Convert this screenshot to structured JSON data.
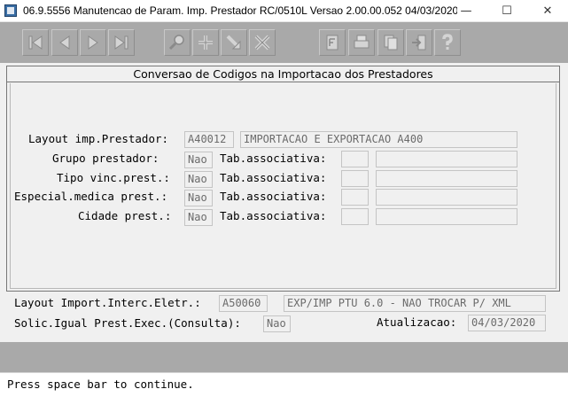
{
  "window": {
    "title": "06.9.5556 Manutencao  de Param. Imp. Prestador RC/0510L Versao 2.00.00.052 04/03/2020...",
    "minimize_glyph": "—",
    "maximize_glyph": "☐",
    "close_glyph": "✕"
  },
  "toolbar": {
    "buttons": [
      {
        "icon": "first-record-icon"
      },
      {
        "icon": "previous-record-icon"
      },
      {
        "icon": "next-record-icon"
      },
      {
        "icon": "last-record-icon"
      },
      {
        "icon": "search-icon"
      },
      {
        "icon": "add-icon"
      },
      {
        "icon": "edit-icon"
      },
      {
        "icon": "delete-icon"
      },
      {
        "icon": "filter-icon"
      },
      {
        "icon": "print-icon"
      },
      {
        "icon": "copy-icon"
      },
      {
        "icon": "exit-icon"
      },
      {
        "icon": "help-icon"
      }
    ]
  },
  "panel": {
    "title": "Conversao de Codigos na Importacao dos Prestadores",
    "rows": [
      {
        "label": "Layout imp.Prestador:",
        "value": "A40012",
        "description": "IMPORTACAO E EXPORTACAO A400"
      },
      {
        "label": "Grupo prestador:",
        "value": "Nao",
        "assoc_label": "Tab.associativa:",
        "assoc_code": "",
        "assoc_desc": ""
      },
      {
        "label": "Tipo vinc.prest.:",
        "value": "Nao",
        "assoc_label": "Tab.associativa:",
        "assoc_code": "",
        "assoc_desc": ""
      },
      {
        "label": "Especial.medica prest.:",
        "value": "Nao",
        "assoc_label": "Tab.associativa:",
        "assoc_code": "",
        "assoc_desc": ""
      },
      {
        "label": "Cidade prest.:",
        "value": "Nao",
        "assoc_label": "Tab.associativa:",
        "assoc_code": "",
        "assoc_desc": ""
      }
    ]
  },
  "footer_fields": {
    "layout_interc_label": "Layout Import.Interc.Eletr.:",
    "layout_interc_value": "A50060",
    "layout_interc_desc": "EXP/IMP PTU 6.0 - NAO TROCAR P/ XML",
    "solic_label": "Solic.Igual Prest.Exec.(Consulta):",
    "solic_value": "Nao",
    "atualizacao_label": "Atualizacao:",
    "atualizacao_value": "04/03/2020"
  },
  "status": {
    "message": "Press space bar to continue."
  },
  "colors": {
    "toolbar_bg": "#a9a9a9",
    "panel_bg": "#f0f0f0",
    "field_text": "#6b6b6b"
  }
}
